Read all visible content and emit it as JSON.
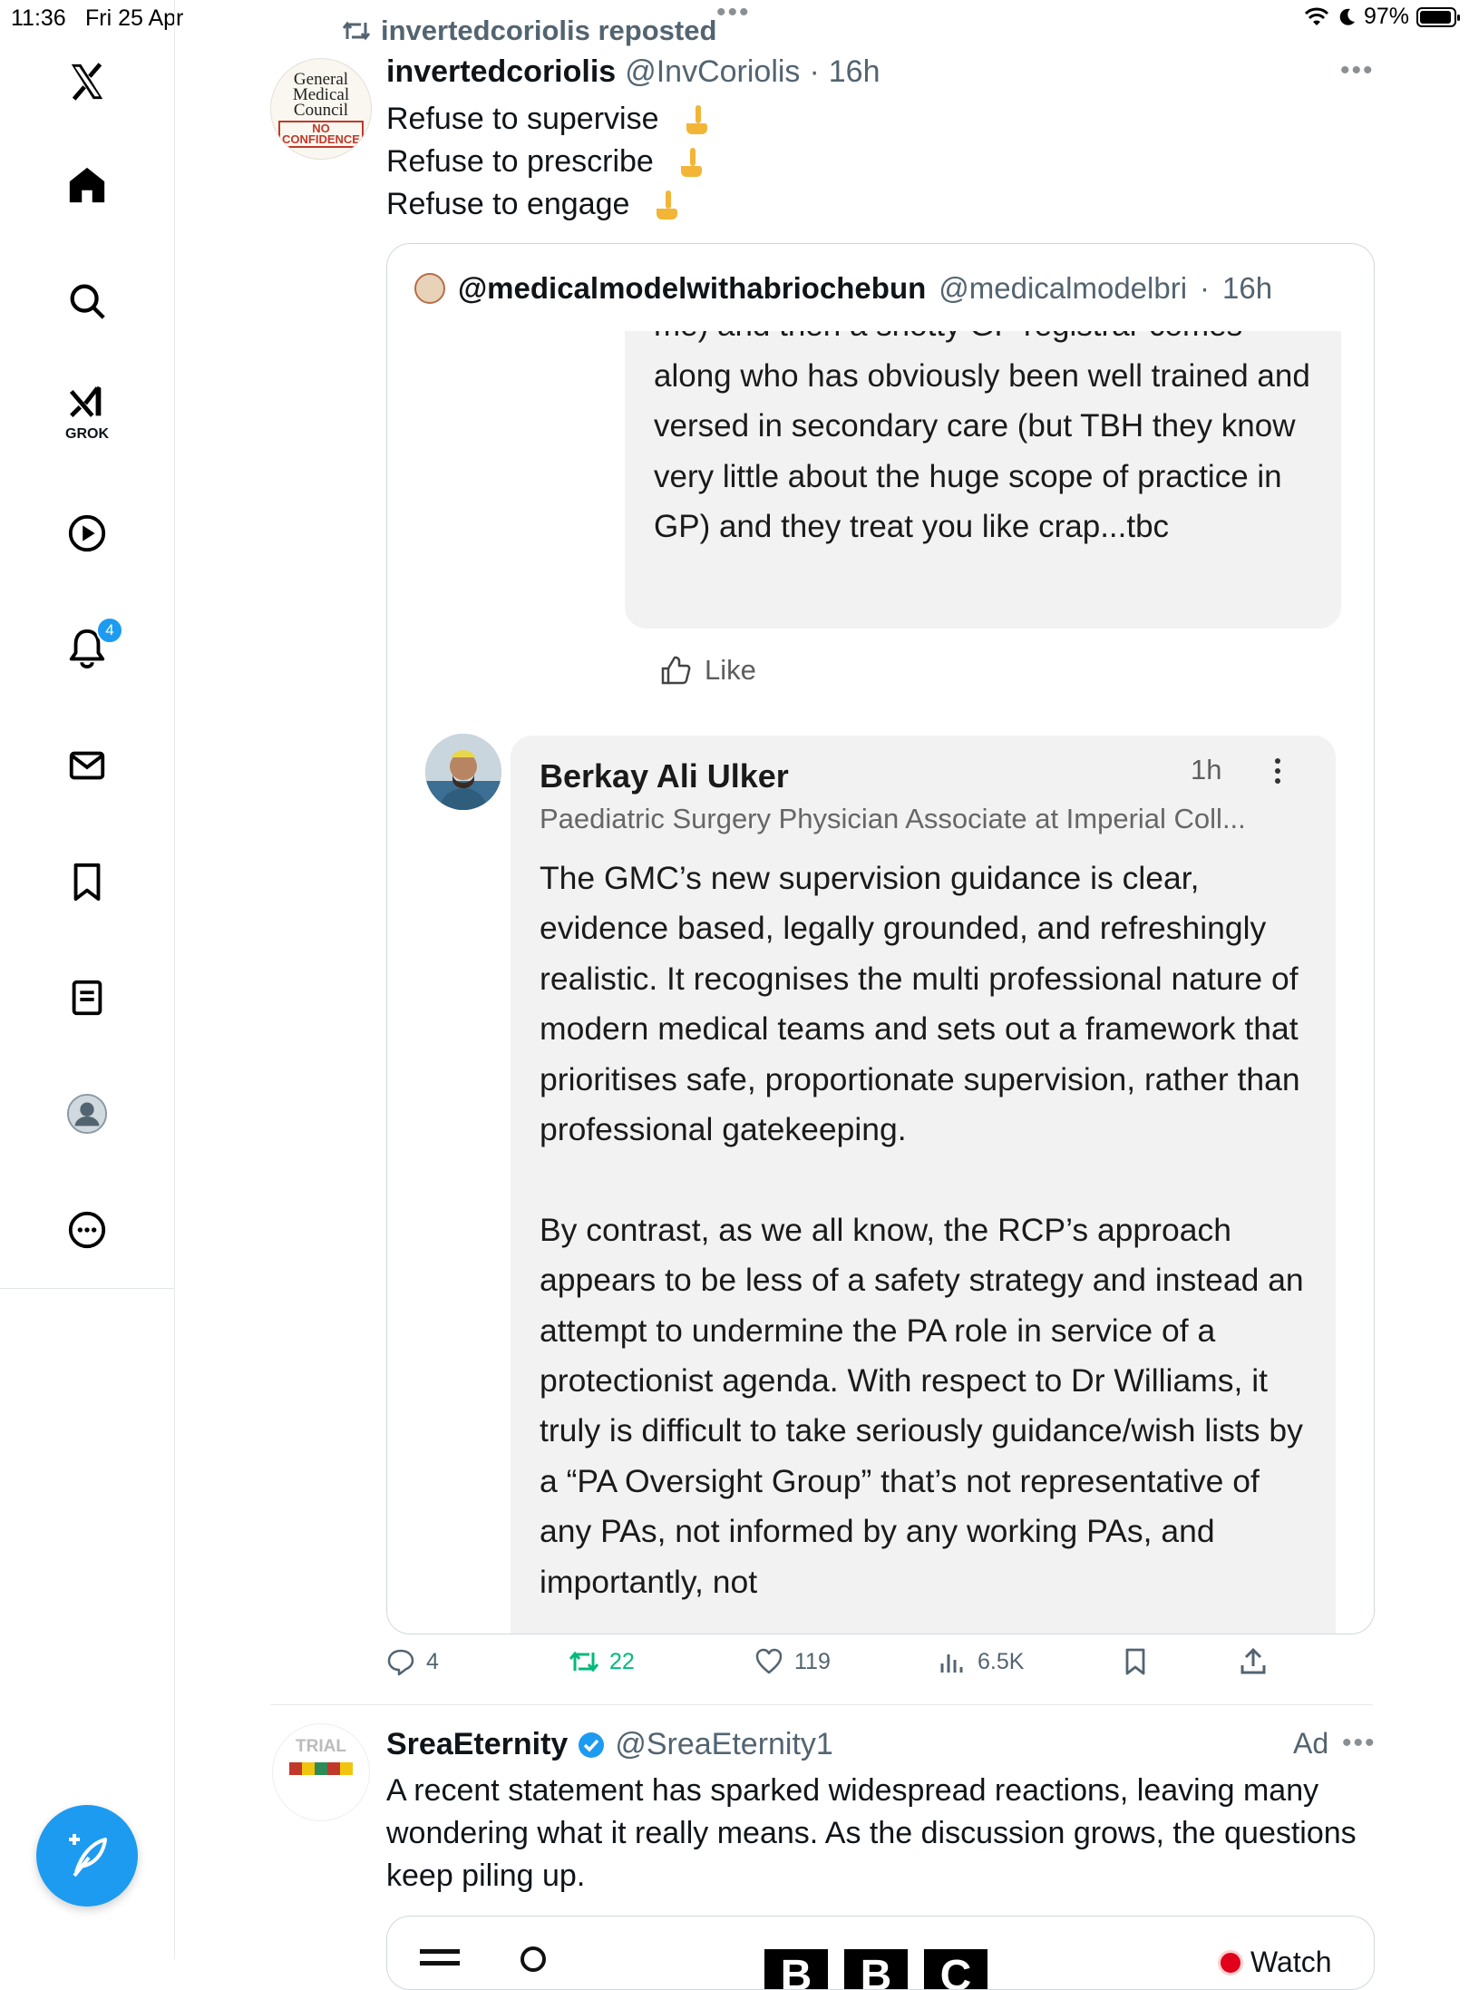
{
  "status_bar": {
    "time": "11:36",
    "date": "Fri 25 Apr",
    "battery": "97%"
  },
  "sidebar": {
    "items": [
      {
        "name": "home",
        "icon": "home-icon"
      },
      {
        "name": "explore",
        "icon": "search-icon"
      },
      {
        "name": "grok",
        "icon": "grok-icon",
        "label": "GROK"
      },
      {
        "name": "videos",
        "icon": "play-icon"
      },
      {
        "name": "notifications",
        "icon": "bell-icon",
        "badge": "4"
      },
      {
        "name": "messages",
        "icon": "mail-icon"
      },
      {
        "name": "bookmarks",
        "icon": "bookmark-icon"
      },
      {
        "name": "lists",
        "icon": "list-icon"
      },
      {
        "name": "profile",
        "icon": "profile-icon"
      },
      {
        "name": "more",
        "icon": "more-icon"
      }
    ]
  },
  "tweet": {
    "repost_label": "invertedcoriolis reposted",
    "author_name": "invertedcoriolis",
    "handle": "@InvCoriolis",
    "separator": "·",
    "time": "16h",
    "avatar": {
      "line1": "General",
      "line2": "Medical",
      "line3": "Council",
      "stamp1": "NO",
      "stamp2": "CONFIDENCE"
    },
    "lines": [
      "Refuse to supervise",
      "Refuse to prescribe",
      "Refuse to engage"
    ],
    "quote": {
      "author_name": "@medicalmodelwithabriochebun",
      "handle": "@medicalmodelbri",
      "separator": "·",
      "time": "16h",
      "bubble_text": "me) and then a snotty GP registrar comes along who has obviously been well trained and versed in secondary care (but TBH they know very little about the huge scope of practice in GP) and they treat you like crap...tbc",
      "like_label": "Like",
      "comment": {
        "name": "Berkay Ali Ulker",
        "time": "1h",
        "headline": "Paediatric Surgery Physician Associate at Imperial Coll...",
        "body": "The GMC’s new supervision guidance is clear, evidence based, legally grounded, and refreshingly realistic. It recognises the multi professional nature of modern medical teams and sets out a framework that prioritises safe, proportionate supervision, rather than professional gatekeeping.\n\nBy contrast, as we all know, the RCP’s approach appears to be less of a safety strategy and instead an attempt to undermine the PA role in service of a protectionist agenda. With respect to Dr Williams, it truly is difficult to take seriously guidance/wish lists by a “PA Oversight Group” that’s not representative of any PAs, not informed by any working PAs, and importantly, not"
      }
    },
    "actions": {
      "replies": "4",
      "reposts": "22",
      "likes": "119",
      "views": "6.5K"
    }
  },
  "ad_tweet": {
    "author_name": "SreaEternity",
    "handle": "@SreaEternity1",
    "ad_label": "Ad",
    "body": "A recent statement has sparked widespread reactions, leaving many wondering what it really means. As the discussion grows, the questions keep piling up.",
    "avatar_text": "TRIAL",
    "card": {
      "logo": [
        "B",
        "B",
        "C"
      ],
      "watch_label": "Watch"
    }
  },
  "colors": {
    "accent": "#1d9bf0",
    "retweet": "#00ba7c",
    "muted": "#536471"
  }
}
